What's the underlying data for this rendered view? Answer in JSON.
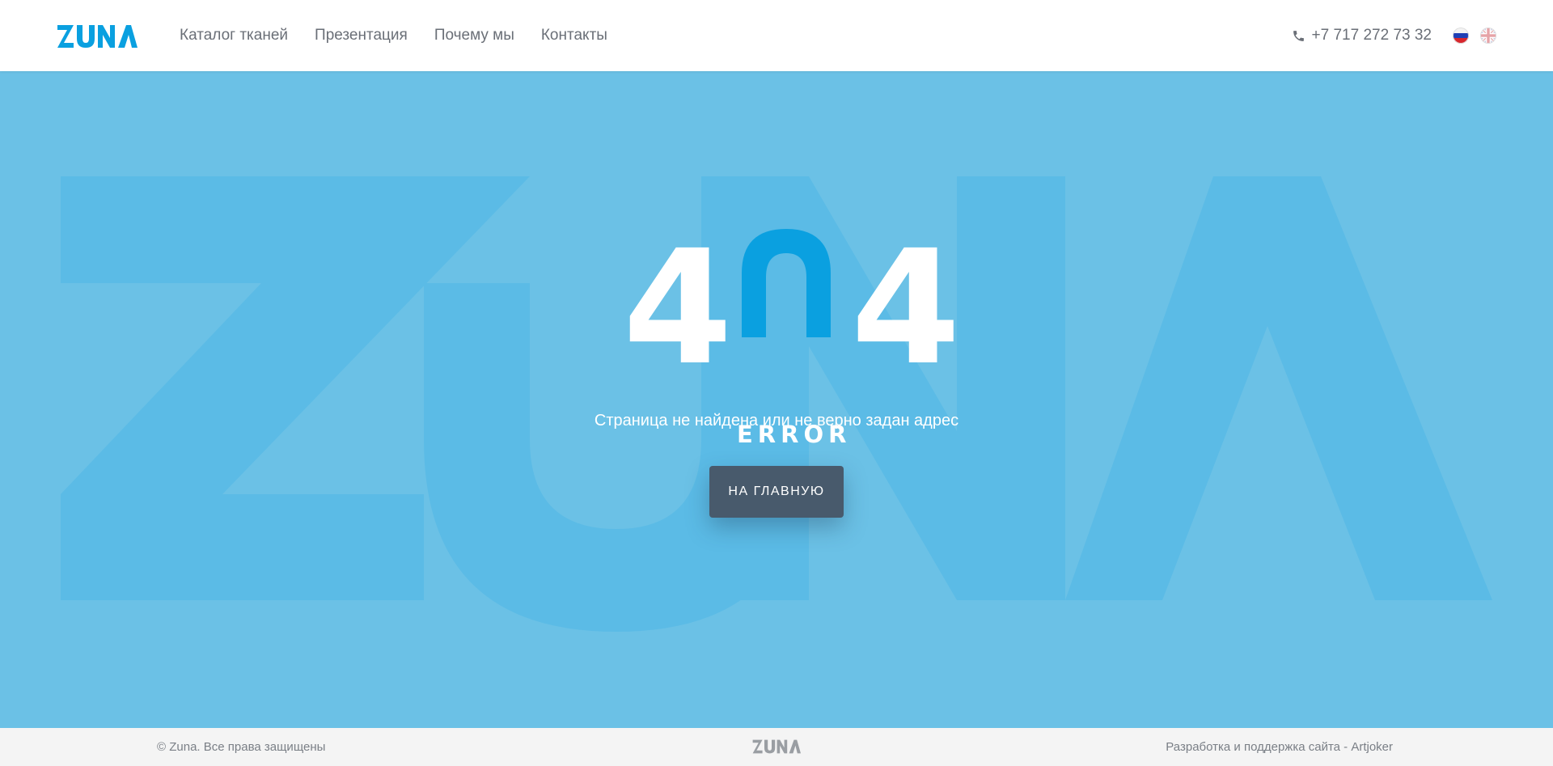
{
  "header": {
    "logo_text": "ZUNA",
    "nav": [
      {
        "label": "Каталог тканей"
      },
      {
        "label": "Презентация"
      },
      {
        "label": "Почему мы"
      },
      {
        "label": "Контакты"
      }
    ],
    "phone": "+7 717 272 73 32",
    "languages": [
      "ru-flag-icon",
      "en-flag-icon"
    ]
  },
  "error": {
    "digit_left": "4",
    "digit_right": "4",
    "word": "ERROR",
    "message": "Страница не найдена или не верно задан адрес",
    "button_label": "НА ГЛАВНУЮ"
  },
  "footer": {
    "copyright": "© Zuna. Все права защищены",
    "logo_text": "ZUNA",
    "developer": "Разработка и поддержка сайта - Artjoker"
  },
  "colors": {
    "brand": "#0aa0e0",
    "hero_bg": "#6bc1e6",
    "watermark": "#5bbbe6",
    "button": "#485a6c",
    "header_bg": "#ffffff",
    "footer_bg": "#f4f4f4",
    "text_muted": "#6a6f77"
  }
}
